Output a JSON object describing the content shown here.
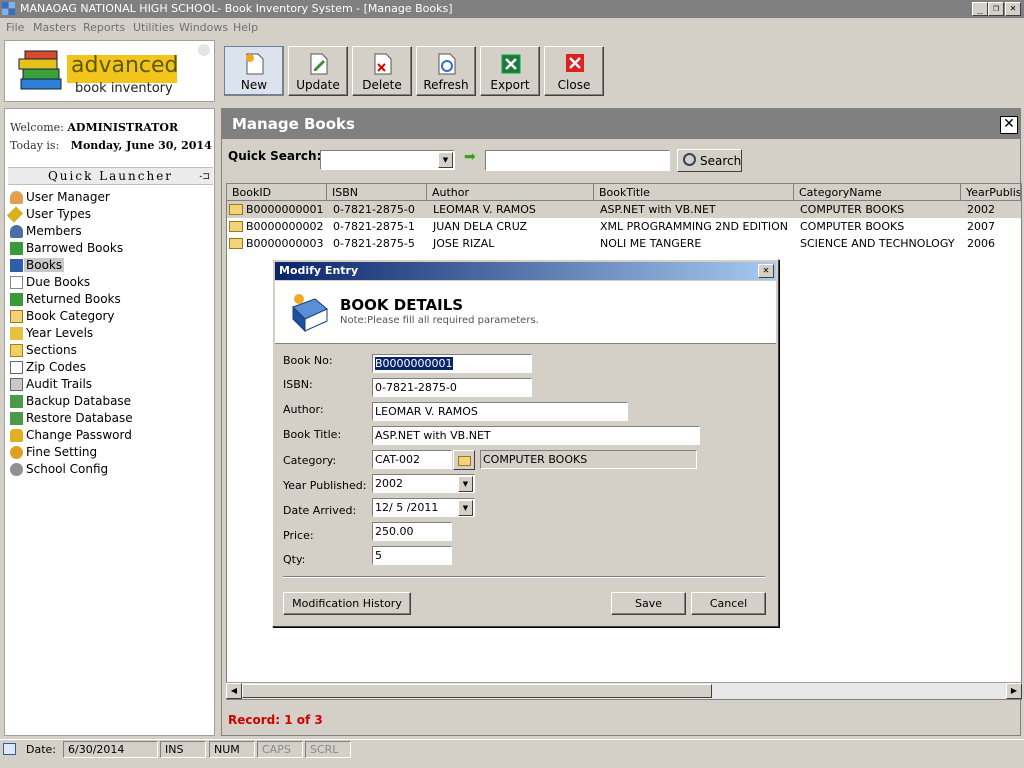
{
  "window": {
    "title": "MANAOAG NATIONAL HIGH SCHOOL- Book Inventory System - [Manage Books]",
    "controls": [
      "_",
      "❐",
      "✕"
    ]
  },
  "menu": [
    "File",
    "Masters",
    "Reports",
    "Utilities",
    "Windows",
    "Help"
  ],
  "logo": {
    "line1": "advanced",
    "line2": "book inventory"
  },
  "toolbar": [
    "New",
    "Update",
    "Delete",
    "Refresh",
    "Export",
    "Close"
  ],
  "sidebar": {
    "welcome_label": "Welcome:",
    "welcome_user": "ADMINISTRATOR",
    "today_label": "Today is:",
    "today_value": "Monday, June 30, 2014",
    "quick_launcher": "Quick Launcher",
    "items": [
      {
        "label": "User Manager",
        "icon": "user-icon"
      },
      {
        "label": "User Types",
        "icon": "key-icon"
      },
      {
        "label": "Members",
        "icon": "members-icon"
      },
      {
        "label": "Barrowed Books",
        "icon": "borrow-icon"
      },
      {
        "label": "Books",
        "icon": "book-icon"
      },
      {
        "label": "Due Books",
        "icon": "due-icon"
      },
      {
        "label": "Returned Books",
        "icon": "return-icon"
      },
      {
        "label": "Book Category",
        "icon": "folder-icon"
      },
      {
        "label": "Year Levels",
        "icon": "pencil-icon"
      },
      {
        "label": "Sections",
        "icon": "list-icon"
      },
      {
        "label": "Zip Codes",
        "icon": "mail-icon"
      },
      {
        "label": "Audit Trails",
        "icon": "trash-icon"
      },
      {
        "label": "Backup Database",
        "icon": "backup-icon"
      },
      {
        "label": "Restore Database",
        "icon": "restore-icon"
      },
      {
        "label": "Change Password",
        "icon": "lock-icon"
      },
      {
        "label": "Fine Setting",
        "icon": "fine-icon"
      },
      {
        "label": "School Config",
        "icon": "gear-icon"
      }
    ]
  },
  "main": {
    "title": "Manage Books",
    "quick_search_label": "Quick Search:",
    "search_button": "Search",
    "columns": [
      "BookID",
      "ISBN",
      "Author",
      "BookTitle",
      "CategoryName",
      "YearPublish"
    ],
    "rows": [
      [
        "B0000000001",
        "0-7821-2875-0",
        "LEOMAR V. RAMOS",
        "ASP.NET with VB.NET",
        "COMPUTER BOOKS",
        "2002"
      ],
      [
        "B0000000002",
        "0-7821-2875-1",
        "JUAN DELA CRUZ",
        "XML PROGRAMMING 2ND EDITION",
        "COMPUTER BOOKS",
        "2007"
      ],
      [
        "B0000000003",
        "0-7821-2875-5",
        "JOSE RIZAL",
        "NOLI ME TANGERE",
        "SCIENCE AND TECHNOLOGY",
        "2006"
      ]
    ],
    "record_text": "Record: 1 of 3"
  },
  "dialog": {
    "title": "Modify Entry",
    "heading": "BOOK DETAILS",
    "note": "Note:Please fill all required parameters.",
    "labels": {
      "book_no": "Book No:",
      "isbn": "ISBN:",
      "author": "Author:",
      "title": "Book Title:",
      "category": "Category:",
      "year": "Year Published:",
      "date": "Date Arrived:",
      "price": "Price:",
      "qty": "Qty:"
    },
    "values": {
      "book_no": "B0000000001",
      "isbn": "0-7821-2875-0",
      "author": "LEOMAR V. RAMOS",
      "title": "ASP.NET with VB.NET",
      "category_code": "CAT-002",
      "category_name": "COMPUTER BOOKS",
      "year": "2002",
      "date": "12/ 5 /2011",
      "price": "250.00",
      "qty": "5"
    },
    "buttons": {
      "history": "Modification History",
      "save": "Save",
      "cancel": "Cancel"
    }
  },
  "status": {
    "date_label": "Date:",
    "date_value": "6/30/2014",
    "ins": "INS",
    "num": "NUM",
    "caps": "CAPS",
    "scrl": "SCRL"
  },
  "colors": {
    "record_text": "#d00000",
    "dialog_title_start": "#0a246a",
    "selection": "#0a246a"
  }
}
